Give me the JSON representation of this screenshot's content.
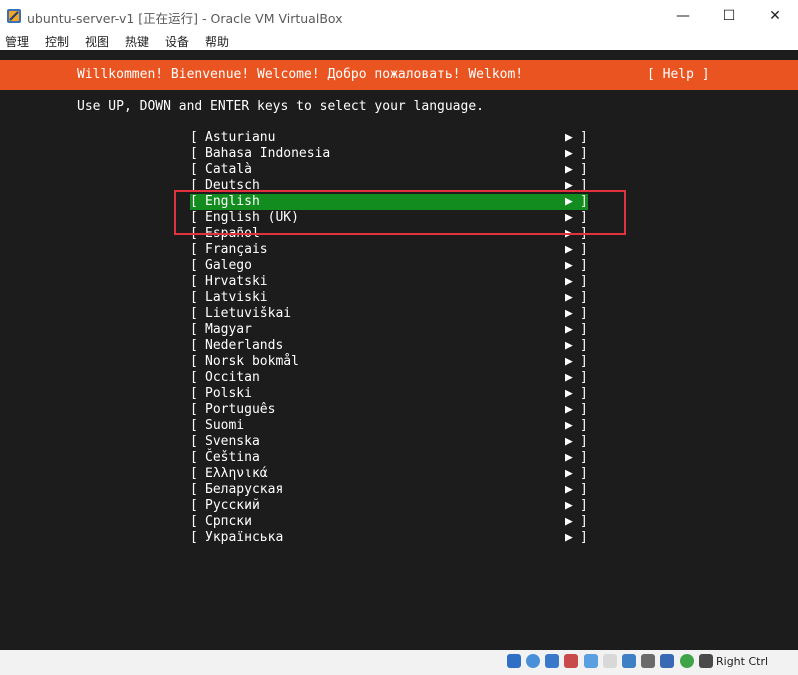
{
  "window": {
    "title": "ubuntu-server-v1 [正在运行] - Oracle VM VirtualBox",
    "minimize": "—",
    "maximize": "☐",
    "close": "✕"
  },
  "menubar": {
    "items": [
      "管理",
      "控制",
      "视图",
      "热键",
      "设备",
      "帮助"
    ]
  },
  "installer": {
    "welcome": "Willkommen! Bienvenue! Welcome! Добро пожаловать! Welkom!",
    "help": "[ Help ]",
    "instruction": "Use UP, DOWN and ENTER keys to select your language.",
    "bracket_left": "[",
    "bracket_right": "]",
    "arrow": "▶",
    "selected_index": 4,
    "languages": [
      "Asturianu",
      "Bahasa Indonesia",
      "Català",
      "Deutsch",
      "English",
      "English (UK)",
      "Español",
      "Français",
      "Galego",
      "Hrvatski",
      "Latviski",
      "Lietuviškai",
      "Magyar",
      "Nederlands",
      "Norsk bokmål",
      "Occitan",
      "Polski",
      "Português",
      "Suomi",
      "Svenska",
      "Čeština",
      "Ελληνικά",
      "Беларуская",
      "Русский",
      "Српски",
      "Українська"
    ]
  },
  "statusbar": {
    "host_key": "Right Ctrl"
  },
  "colors": {
    "accent": "#e95420",
    "selected": "#128c1e",
    "annotation": "#e0333c",
    "console_bg": "#1c1c1c"
  }
}
